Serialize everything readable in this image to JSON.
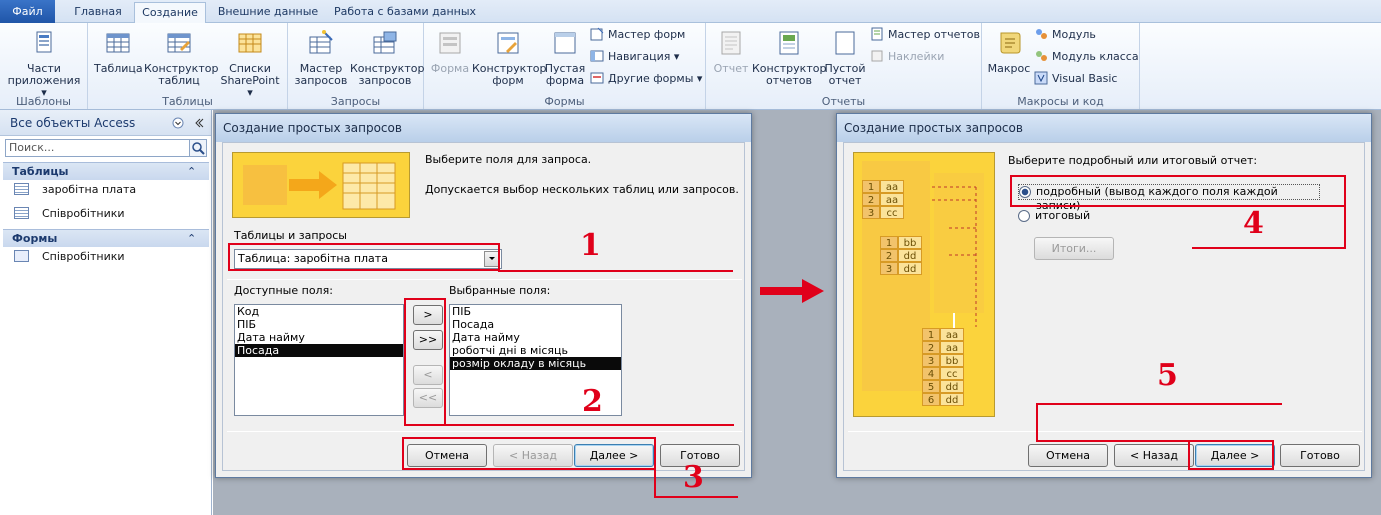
{
  "ribbon": {
    "tabs": [
      "Файл",
      "Главная",
      "Создание",
      "Внешние данные",
      "Работа с базами данных"
    ],
    "groups": {
      "templates": {
        "label": "Шаблоны",
        "parts_line1": "Части",
        "parts_line2": "приложения ▾"
      },
      "tables": {
        "label": "Таблицы",
        "table": "Таблица",
        "designer_line1": "Конструктор",
        "designer_line2": "таблиц",
        "sp_line1": "Списки",
        "sp_line2": "SharePoint ▾"
      },
      "queries": {
        "label": "Запросы",
        "wizard_line1": "Мастер",
        "wizard_line2": "запросов",
        "designer_line1": "Конструктор",
        "designer_line2": "запросов"
      },
      "forms": {
        "label": "Формы",
        "form": "Форма",
        "designer_line1": "Конструктор",
        "designer_line2": "форм",
        "blank_line1": "Пустая",
        "blank_line2": "форма",
        "wizard": "Мастер форм",
        "navigation": "Навигация ▾",
        "other": "Другие формы ▾"
      },
      "reports": {
        "label": "Отчеты",
        "report": "Отчет",
        "designer_line1": "Конструктор",
        "designer_line2": "отчетов",
        "blank_line1": "Пустой",
        "blank_line2": "отчет",
        "wizard": "Мастер отчетов",
        "labels": "Наклейки"
      },
      "macros": {
        "label": "Макросы и код",
        "macro": "Макрос",
        "module": "Модуль",
        "class_module": "Модуль класса",
        "vb": "Visual Basic"
      }
    }
  },
  "nav": {
    "header": "Все объекты Access",
    "search_placeholder": "Поиск...",
    "sections": [
      {
        "title": "Таблицы",
        "items": [
          "заробітна плата",
          "Співробітники"
        ]
      },
      {
        "title": "Формы",
        "items": [
          "Співробітники"
        ]
      }
    ]
  },
  "dialog1": {
    "title": "Создание простых запросов",
    "prompt": "Выберите поля для запроса.",
    "hint": "Допускается выбор нескольких таблиц или запросов.",
    "tables_label": "Таблицы и запросы",
    "combo_value": "Таблица: заробітна плата",
    "available_label": "Доступные поля:",
    "available": [
      "Код",
      "ПІБ",
      "Дата найму",
      "Посада"
    ],
    "selected_label": "Выбранные поля:",
    "selected": [
      "ПІБ",
      "Посада",
      "Дата найму",
      "роботчі дні в місяць",
      "розмір окладу в місяць"
    ],
    "move": [
      ">",
      ">>",
      "<",
      "<<"
    ],
    "buttons": {
      "cancel": "Отмена",
      "back": "< Назад",
      "next": "Далее >",
      "finish": "Готово"
    }
  },
  "dialog2": {
    "title": "Создание простых запросов",
    "prompt": "Выберите подробный или итоговый отчет:",
    "option_detail": "подробный (вывод каждого поля каждой записи)",
    "option_summary": "итоговый",
    "totals_button": "Итоги...",
    "buttons": {
      "cancel": "Отмена",
      "back": "< Назад",
      "next": "Далее >",
      "finish": "Готово"
    },
    "illus_rows1": [
      [
        "1",
        "aa"
      ],
      [
        "2",
        "aa"
      ],
      [
        "3",
        "cc"
      ]
    ],
    "illus_rows2": [
      [
        "1",
        "bb"
      ],
      [
        "2",
        "dd"
      ],
      [
        "3",
        "dd"
      ]
    ],
    "illus_rows3": [
      [
        "1",
        "aa"
      ],
      [
        "2",
        "aa"
      ],
      [
        "3",
        "bb"
      ],
      [
        "4",
        "cc"
      ],
      [
        "5",
        "dd"
      ],
      [
        "6",
        "dd"
      ]
    ]
  },
  "annotations": [
    "1",
    "2",
    "3",
    "4",
    "5"
  ],
  "colors": {
    "annotation": "#e0001a",
    "accent": "#fbd33c"
  }
}
